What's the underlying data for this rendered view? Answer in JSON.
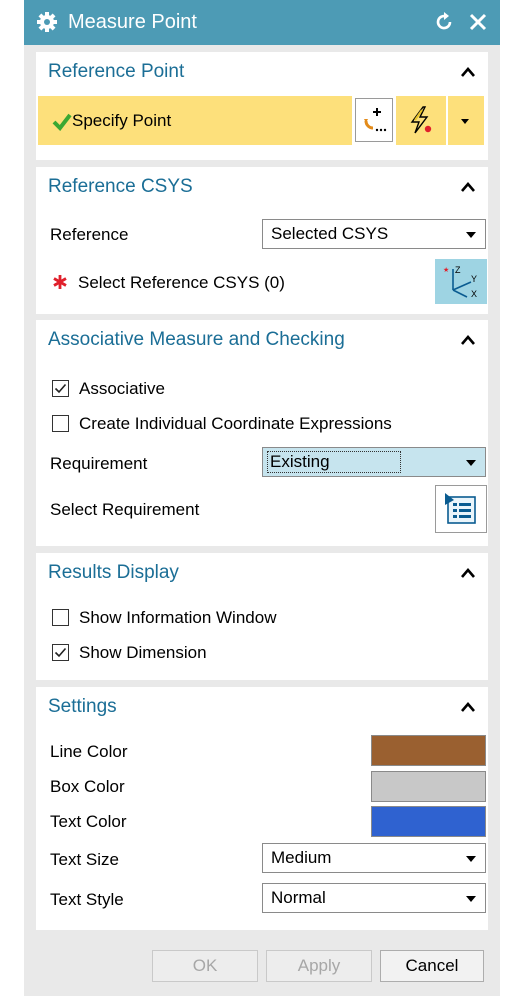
{
  "window": {
    "title": "Measure Point"
  },
  "reference_point": {
    "title": "Reference Point",
    "specify_label": "Specify Point"
  },
  "reference_csys": {
    "title": "Reference CSYS",
    "reference_label": "Reference",
    "reference_value": "Selected CSYS",
    "select_label": "Select Reference CSYS (0)"
  },
  "associative": {
    "title": "Associative Measure and Checking",
    "associative_label": "Associative",
    "associative_checked": true,
    "individual_label": "Create Individual Coordinate Expressions",
    "individual_checked": false,
    "requirement_label": "Requirement",
    "requirement_value": "Existing",
    "select_requirement_label": "Select Requirement"
  },
  "results_display": {
    "title": "Results Display",
    "info_window_label": "Show Information Window",
    "info_window_checked": false,
    "dimension_label": "Show Dimension",
    "dimension_checked": true
  },
  "settings": {
    "title": "Settings",
    "line_color_label": "Line Color",
    "line_color": "#9a6030",
    "box_color_label": "Box Color",
    "box_color": "#c8c8c8",
    "text_color_label": "Text Color",
    "text_color": "#2f62d0",
    "text_size_label": "Text Size",
    "text_size_value": "Medium",
    "text_style_label": "Text Style",
    "text_style_value": "Normal"
  },
  "buttons": {
    "ok": "OK",
    "apply": "Apply",
    "cancel": "Cancel"
  },
  "colors": {
    "title_bar": "#4d9bb5",
    "section_title": "#1b6e96",
    "highlight": "#fde07b",
    "required_star": "#e0202b"
  }
}
